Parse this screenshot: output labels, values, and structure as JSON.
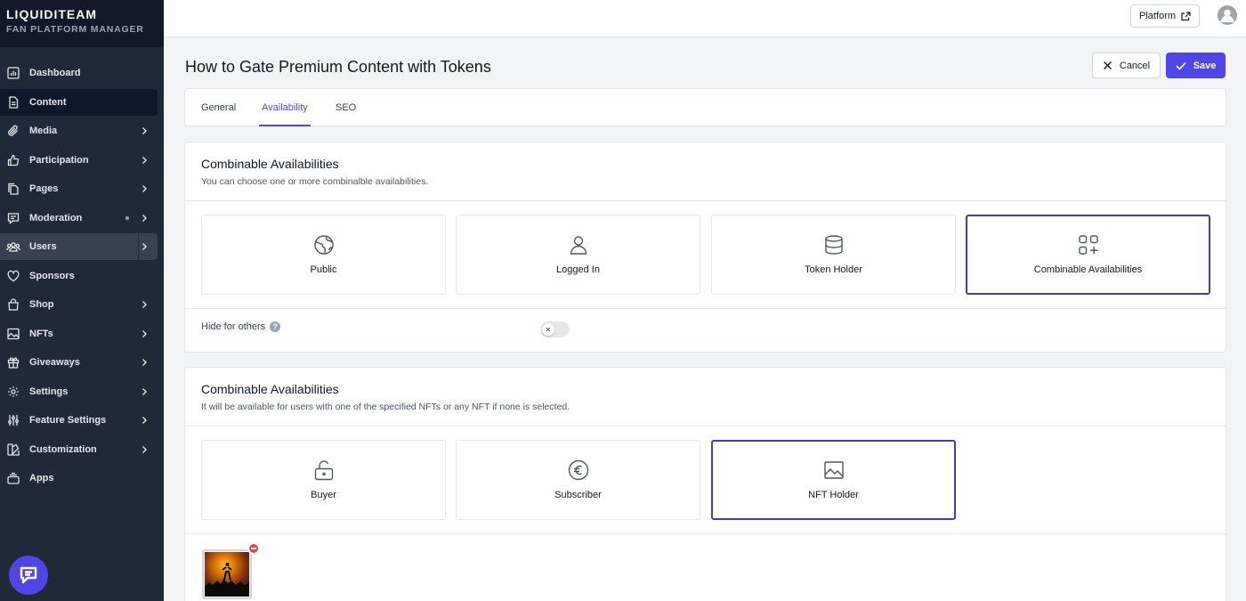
{
  "brand": {
    "name": "LIQUIDITEAM",
    "subtitle": "FAN PLATFORM MANAGER"
  },
  "sidebar": {
    "items": [
      {
        "label": "Dashboard",
        "icon": "chart-icon",
        "has_chevron": false
      },
      {
        "label": "Content",
        "icon": "document-icon",
        "has_chevron": false,
        "active": true
      },
      {
        "label": "Media",
        "icon": "paperclip-icon",
        "has_chevron": true
      },
      {
        "label": "Participation",
        "icon": "thumbs-up-icon",
        "has_chevron": true
      },
      {
        "label": "Pages",
        "icon": "pages-icon",
        "has_chevron": true
      },
      {
        "label": "Moderation",
        "icon": "chat-icon",
        "has_chevron": true,
        "has_dot": true
      },
      {
        "label": "Users",
        "icon": "users-icon",
        "has_chevron": true,
        "hover": true
      },
      {
        "label": "Sponsors",
        "icon": "heart-icon",
        "has_chevron": false
      },
      {
        "label": "Shop",
        "icon": "shopping-bag-icon",
        "has_chevron": true
      },
      {
        "label": "NFTs",
        "icon": "image-icon",
        "has_chevron": true
      },
      {
        "label": "Giveaways",
        "icon": "gift-icon",
        "has_chevron": true
      },
      {
        "label": "Settings",
        "icon": "gear-icon",
        "has_chevron": true
      },
      {
        "label": "Feature Settings",
        "icon": "sliders-icon",
        "has_chevron": true
      },
      {
        "label": "Customization",
        "icon": "palette-icon",
        "has_chevron": true
      },
      {
        "label": "Apps",
        "icon": "app-stack-icon",
        "has_chevron": false
      }
    ]
  },
  "topbar": {
    "platform_label": "Platform"
  },
  "header": {
    "title": "How to Gate Premium Content with Tokens",
    "cancel_label": "Cancel",
    "save_label": "Save"
  },
  "tabs": [
    {
      "label": "General",
      "active": false
    },
    {
      "label": "Availability",
      "active": true
    },
    {
      "label": "SEO",
      "active": false
    }
  ],
  "section1": {
    "title": "Combinable Availabilities",
    "description": "You can choose one or more combinalble availabilities.",
    "options": [
      {
        "label": "Public",
        "icon": "globe-icon",
        "selected": false
      },
      {
        "label": "Logged In",
        "icon": "user-icon",
        "selected": false
      },
      {
        "label": "Token Holder",
        "icon": "database-icon",
        "selected": false
      },
      {
        "label": "Combinable Availabilities",
        "icon": "grid-plus-icon",
        "selected": true
      }
    ],
    "hide_label": "Hide for others",
    "hide_enabled": false
  },
  "section2": {
    "title": "Combinable Availabilities",
    "description": "It will be available for users with one of the specified NFTs or any NFT if none is selected.",
    "options": [
      {
        "label": "Buyer",
        "icon": "unlock-icon",
        "selected": false
      },
      {
        "label": "Subscriber",
        "icon": "euro-icon",
        "selected": false
      },
      {
        "label": "NFT Holder",
        "icon": "image-icon",
        "selected": true
      }
    ]
  },
  "colors": {
    "accent": "#4f46e5",
    "sidebar_bg": "#1f2937",
    "remove_red": "#ef4444"
  }
}
